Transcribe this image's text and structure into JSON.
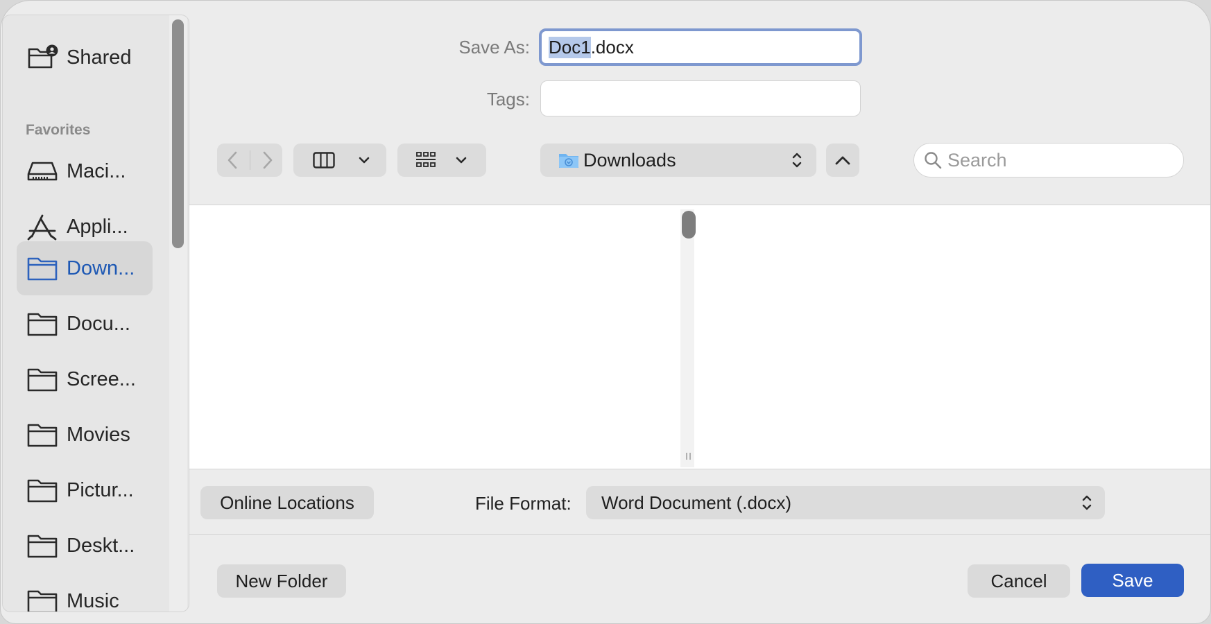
{
  "sidebar": {
    "shared_label": "Shared",
    "favorites_heading": "Favorites",
    "items": [
      {
        "label": "Maci...",
        "icon": "drive-icon"
      },
      {
        "label": "Appli...",
        "icon": "applications-icon"
      },
      {
        "label": "Down...",
        "icon": "folder-icon",
        "selected": true
      },
      {
        "label": "Docu...",
        "icon": "folder-icon"
      },
      {
        "label": "Scree...",
        "icon": "folder-icon"
      },
      {
        "label": "Movies",
        "icon": "folder-icon"
      },
      {
        "label": "Pictur...",
        "icon": "folder-icon"
      },
      {
        "label": "Deskt...",
        "icon": "folder-icon"
      },
      {
        "label": "Music",
        "icon": "folder-icon"
      }
    ]
  },
  "form": {
    "save_as_label": "Save As:",
    "filename_selected": "Doc1",
    "filename_ext": ".docx",
    "tags_label": "Tags:",
    "tags_value": ""
  },
  "toolbar": {
    "location": "Downloads",
    "search_placeholder": "Search"
  },
  "bottom": {
    "online_locations": "Online Locations",
    "file_format_label": "File Format:",
    "file_format_value": "Word Document (.docx)",
    "new_folder": "New Folder",
    "cancel": "Cancel",
    "save": "Save"
  },
  "colors": {
    "accent": "#2f5fc3",
    "selected_text": "#1d58b4",
    "focus_ring": "#7e98cf",
    "text_selection": "#b5c9ea"
  }
}
